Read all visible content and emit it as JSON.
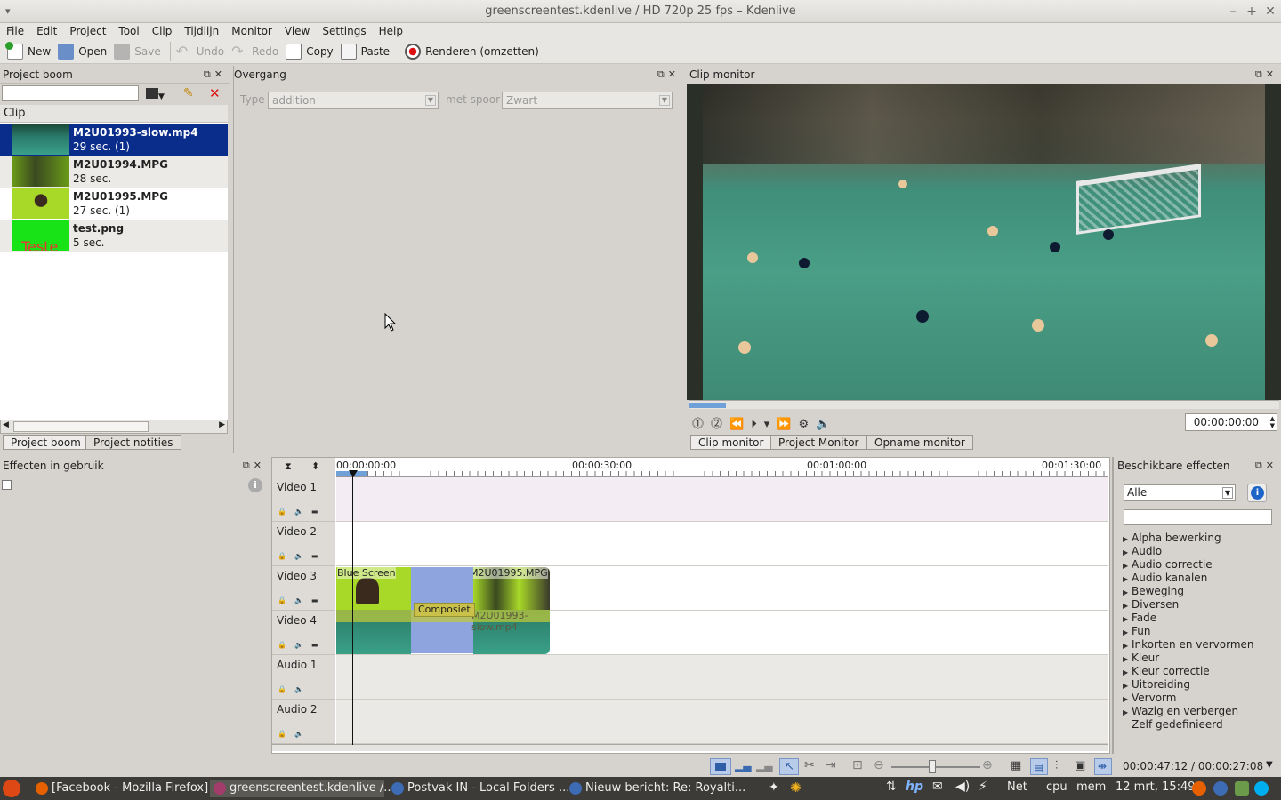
{
  "window": {
    "title": "greenscreentest.kdenlive / HD 720p 25 fps – Kdenlive"
  },
  "menu": [
    "File",
    "Edit",
    "Project",
    "Tool",
    "Clip",
    "Tijdlijn",
    "Monitor",
    "View",
    "Settings",
    "Help"
  ],
  "toolbar": {
    "new": "New",
    "open": "Open",
    "save": "Save",
    "undo": "Undo",
    "redo": "Redo",
    "copy": "Copy",
    "paste": "Paste",
    "render": "Renderen (omzetten)"
  },
  "project_bin": {
    "title": "Project boom",
    "column": "Clip",
    "clips": [
      {
        "name": "M2U01993-slow.mp4",
        "duration": "29 sec. (1)"
      },
      {
        "name": "M2U01994.MPG",
        "duration": "28 sec."
      },
      {
        "name": "M2U01995.MPG",
        "duration": "27 sec. (1)"
      },
      {
        "name": "test.png",
        "duration": "5 sec."
      }
    ],
    "thumb_text": "Teste",
    "tab_bin": "Project boom",
    "tab_notes": "Project notities"
  },
  "transition": {
    "title": "Overgang",
    "type_label": "Type",
    "type_value": "addition",
    "track_label": "met spoor",
    "track_value": "Zwart"
  },
  "clip_monitor": {
    "title": "Clip monitor",
    "timecode": "00:00:00:00",
    "tabs": [
      "Clip monitor",
      "Project Monitor",
      "Opname monitor"
    ]
  },
  "effects_in_use": {
    "title": "Effecten in gebruik"
  },
  "timeline": {
    "ruler": [
      "00:00:00:00",
      "00:00:30:00",
      "00:01:00:00",
      "00:01:30:00"
    ],
    "tracks": [
      "Video 1",
      "Video 2",
      "Video 3",
      "Video 4",
      "Audio 1",
      "Audio 2"
    ],
    "clip_a_label": "Blue Screen",
    "clip_b_label": "M2U01995.MPG",
    "clip_c_label": "M2U01993-slow.mp4",
    "transition_label": "Composiet"
  },
  "available_effects": {
    "title": "Beschikbare effecten",
    "filter": "Alle",
    "items": [
      "Alpha bewerking",
      "Audio",
      "Audio correctie",
      "Audio kanalen",
      "Beweging",
      "Diversen",
      "Fade",
      "Fun",
      "Inkorten en vervormen",
      "Kleur",
      "Kleur correctie",
      "Uitbreiding",
      "Vervorm",
      "Wazig en verbergen",
      "Zelf gedefinieerd"
    ]
  },
  "status": {
    "timecode": "00:00:47:12 / 00:00:27:08"
  },
  "taskbar": {
    "tasks": [
      "[Facebook - Mozilla Firefox]",
      "greenscreentest.kdenlive /...",
      "Postvak IN - Local Folders ...",
      "Nieuw bericht: Re: Royalti..."
    ],
    "net": "Net",
    "cpu": "cpu",
    "mem": "mem",
    "clock": "12 mrt, 15:49"
  },
  "colors": {
    "selection": "#0a2c8a",
    "green_screen": "#7ad319",
    "taskbar": "#3c3b37",
    "transition_blue": "#8ea4de"
  }
}
